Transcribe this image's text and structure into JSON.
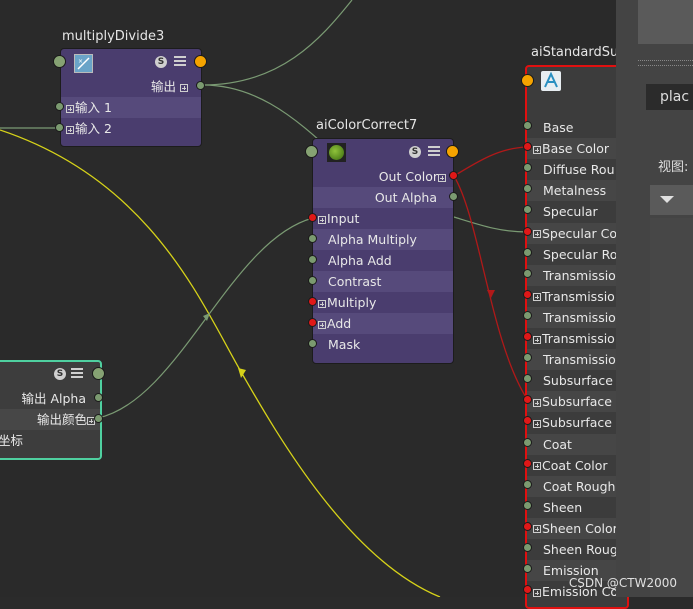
{
  "nodes": {
    "multiply_divide": {
      "title": "multiplyDivide3",
      "output_label": "输出",
      "inputs": [
        "输入 1",
        "输入 2"
      ]
    },
    "color_correct": {
      "title": "aiColorCorrect7",
      "outputs": [
        "Out Color",
        "Out Alpha"
      ],
      "inputs": [
        "Input",
        "Alpha Multiply",
        "Alpha Add",
        "Contrast",
        "Multiply",
        "Add",
        "Mask"
      ]
    },
    "standard_surface": {
      "title": "aiStandardSu",
      "attrs": [
        "Base",
        "Base Color",
        "Diffuse Rou",
        "Metalness",
        "Specular",
        "Specular Co",
        "Specular Ro",
        "Transmissio",
        "Transmissio",
        "Transmissio",
        "Transmissio",
        "Transmissio",
        "Subsurface",
        "Subsurface",
        "Subsurface",
        "Coat",
        "Coat Color",
        "Coat Rough",
        "Sheen",
        "Sheen Color",
        "Sheen Roug",
        "Emission",
        "Emission Co"
      ]
    },
    "texture": {
      "outputs": [
        "输出 Alpha",
        "输出颜色"
      ],
      "partial_label": "坐标"
    }
  },
  "right_panel": {
    "field_value": "plac",
    "view_label": "视图:"
  },
  "watermark": "CSDN @CTW2000",
  "colors": {
    "node_bg": "#4a3d6e",
    "node_row_alt": "#564a7b",
    "wire_green": "#7a9a73",
    "wire_yellow": "#d6d219",
    "wire_red": "#b01919",
    "selected_border": "#e01010",
    "texture_border": "#4fd0a0"
  }
}
